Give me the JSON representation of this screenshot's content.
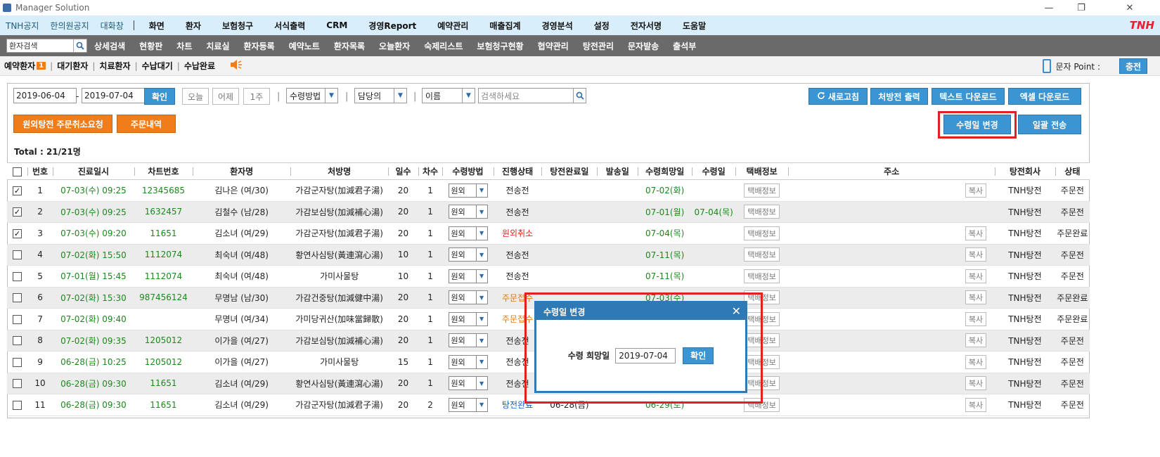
{
  "window": {
    "title": "Manager Solution",
    "minimize": "—",
    "restore": "❐",
    "close": "✕"
  },
  "menubar": {
    "left_items": [
      "TNH공지",
      "한의원공지",
      "대화창"
    ],
    "items": [
      "화면",
      "환자",
      "보험청구",
      "서식출력",
      "CRM",
      "경영Report",
      "예약관리",
      "매출집계",
      "경영분석",
      "설정",
      "전자서명",
      "도움말"
    ],
    "brand": "TNH"
  },
  "toolbar": {
    "search_placeholder": "환자검색",
    "items": [
      "상세검색",
      "현황판",
      "차트",
      "치료실",
      "환자등록",
      "예약노트",
      "환자목록",
      "오늘환자",
      "숙제리스트",
      "보험청구현황",
      "협약관리",
      "탕전관리",
      "문자발송",
      "출석부"
    ]
  },
  "subnav": {
    "items": [
      "예약환자",
      "대기환자",
      "치료환자",
      "수납대기",
      "수납완료"
    ],
    "badge": "1",
    "sms_label": "문자 Point :",
    "charge_label": "충전"
  },
  "filters": {
    "date_from": "2019-06-04",
    "date_sep": "-",
    "date_to": "2019-07-04",
    "confirm": "확인",
    "today": "오늘",
    "yesterday": "어제",
    "week": "1주",
    "method": "수령방법",
    "manager": "담당의",
    "name": "이름",
    "search_placeholder": "검색하세요",
    "refresh": "새로고침",
    "print": "처방전 출력",
    "text_download": "텍스트 다운로드",
    "excel_download": "엑셀 다운로드"
  },
  "actions": {
    "cancel_request": "원외탕전 주문취소요청",
    "order_history": "주문내역",
    "change_date": "수령일 변경",
    "batch_send": "일괄 전송"
  },
  "total": "Total : 21/21명",
  "table": {
    "headers": [
      "번호",
      "진료일시",
      "차트번호",
      "환자명",
      "처방명",
      "일수",
      "차수",
      "수령방법",
      "진행상태",
      "탕전완료일",
      "발송일",
      "수령희망일",
      "수령일",
      "택배정보",
      "주소",
      "탕전회사",
      "상태"
    ],
    "delivery_btn": "택배정보",
    "copy_btn": "복사",
    "rows": [
      {
        "checked": true,
        "no": "1",
        "date": "07-03(수) 09:25",
        "chart": "12345685",
        "name": "김나은 (여/30)",
        "rx": "가감군자탕(加減君子湯)",
        "days": "20",
        "round": "1",
        "method": "원외",
        "status": "전송전",
        "status_color": "normal",
        "done": "",
        "sent": "",
        "wish": "07-02(화)",
        "recv": "",
        "copy": true,
        "company": "TNH탕전",
        "state": "주문전"
      },
      {
        "checked": true,
        "no": "2",
        "date": "07-03(수) 09:25",
        "chart": "1632457",
        "name": "김철수 (남/28)",
        "rx": "가감보심탕(加減補心湯)",
        "days": "20",
        "round": "1",
        "method": "원외",
        "status": "전송전",
        "status_color": "normal",
        "done": "",
        "sent": "",
        "wish": "07-01(월)",
        "recv": "07-04(목)",
        "copy": false,
        "company": "TNH탕전",
        "state": "주문전"
      },
      {
        "checked": true,
        "no": "3",
        "date": "07-03(수) 09:20",
        "chart": "11651",
        "name": "김소녀 (여/29)",
        "rx": "가감군자탕(加減君子湯)",
        "days": "20",
        "round": "1",
        "method": "원외",
        "status": "원외취소",
        "status_color": "red",
        "done": "",
        "sent": "",
        "wish": "07-04(목)",
        "recv": "",
        "copy": true,
        "company": "TNH탕전",
        "state": "주문완료"
      },
      {
        "checked": false,
        "no": "4",
        "date": "07-02(화) 15:50",
        "chart": "1112074",
        "name": "최숙녀 (여/48)",
        "rx": "황연사심탕(黃連瀉心湯)",
        "days": "10",
        "round": "1",
        "method": "원외",
        "status": "전송전",
        "status_color": "normal",
        "done": "",
        "sent": "",
        "wish": "07-11(목)",
        "recv": "",
        "copy": true,
        "company": "TNH탕전",
        "state": "주문전"
      },
      {
        "checked": false,
        "no": "5",
        "date": "07-01(월) 15:45",
        "chart": "1112074",
        "name": "최숙녀 (여/48)",
        "rx": "가미사물탕",
        "days": "10",
        "round": "1",
        "method": "원외",
        "status": "전송전",
        "status_color": "normal",
        "done": "",
        "sent": "",
        "wish": "07-11(목)",
        "recv": "",
        "copy": true,
        "company": "TNH탕전",
        "state": "주문전"
      },
      {
        "checked": false,
        "no": "6",
        "date": "07-02(화) 15:30",
        "chart": "987456124",
        "name": "무명남 (남/30)",
        "rx": "가감건중탕(加減健中湯)",
        "days": "20",
        "round": "1",
        "method": "원외",
        "status": "주문접수",
        "status_color": "orange",
        "done": "",
        "sent": "",
        "wish": "07-03(수)",
        "recv": "",
        "copy": true,
        "company": "TNH탕전",
        "state": "주문완료"
      },
      {
        "checked": false,
        "no": "7",
        "date": "07-02(화) 09:40",
        "chart": "",
        "name": "무명녀 (여/34)",
        "rx": "가미당귀산(加味當歸散)",
        "days": "20",
        "round": "1",
        "method": "원외",
        "status": "주문접수",
        "status_color": "orange",
        "done": "",
        "sent": "",
        "wish": "",
        "recv": "",
        "copy": true,
        "company": "TNH탕전",
        "state": "주문완료"
      },
      {
        "checked": false,
        "no": "8",
        "date": "07-02(화) 09:35",
        "chart": "1205012",
        "name": "이가을 (여/27)",
        "rx": "가감보심탕(加減補心湯)",
        "days": "20",
        "round": "1",
        "method": "원외",
        "status": "전송전",
        "status_color": "normal",
        "done": "",
        "sent": "",
        "wish": "",
        "recv": "",
        "copy": true,
        "company": "TNH탕전",
        "state": "주문전"
      },
      {
        "checked": false,
        "no": "9",
        "date": "06-28(금) 10:25",
        "chart": "1205012",
        "name": "이가을 (여/27)",
        "rx": "가미사물탕",
        "days": "15",
        "round": "1",
        "method": "원외",
        "status": "전송전",
        "status_color": "normal",
        "done": "",
        "sent": "",
        "wish": "",
        "recv": "",
        "copy": true,
        "company": "TNH탕전",
        "state": "주문전"
      },
      {
        "checked": false,
        "no": "10",
        "date": "06-28(금) 09:30",
        "chart": "11651",
        "name": "김소녀 (여/29)",
        "rx": "황연사심탕(黃連瀉心湯)",
        "days": "20",
        "round": "1",
        "method": "원외",
        "status": "전송전",
        "status_color": "normal",
        "done": "",
        "sent": "",
        "wish": "",
        "recv": "",
        "copy": true,
        "company": "TNH탕전",
        "state": "주문전"
      },
      {
        "checked": false,
        "no": "11",
        "date": "06-28(금) 09:30",
        "chart": "11651",
        "name": "김소녀 (여/29)",
        "rx": "가감군자탕(加減君子湯)",
        "days": "20",
        "round": "2",
        "method": "원외",
        "status": "탕전완료",
        "status_color": "blue",
        "done": "06-28(금)",
        "sent": "",
        "wish": "06-29(토)",
        "recv": "",
        "copy": true,
        "company": "TNH탕전",
        "state": "주문전"
      }
    ]
  },
  "dialog": {
    "title": "수령일 변경",
    "close": "✕",
    "label": "수령 희망일",
    "value": "2019-07-04",
    "confirm": "확인"
  }
}
